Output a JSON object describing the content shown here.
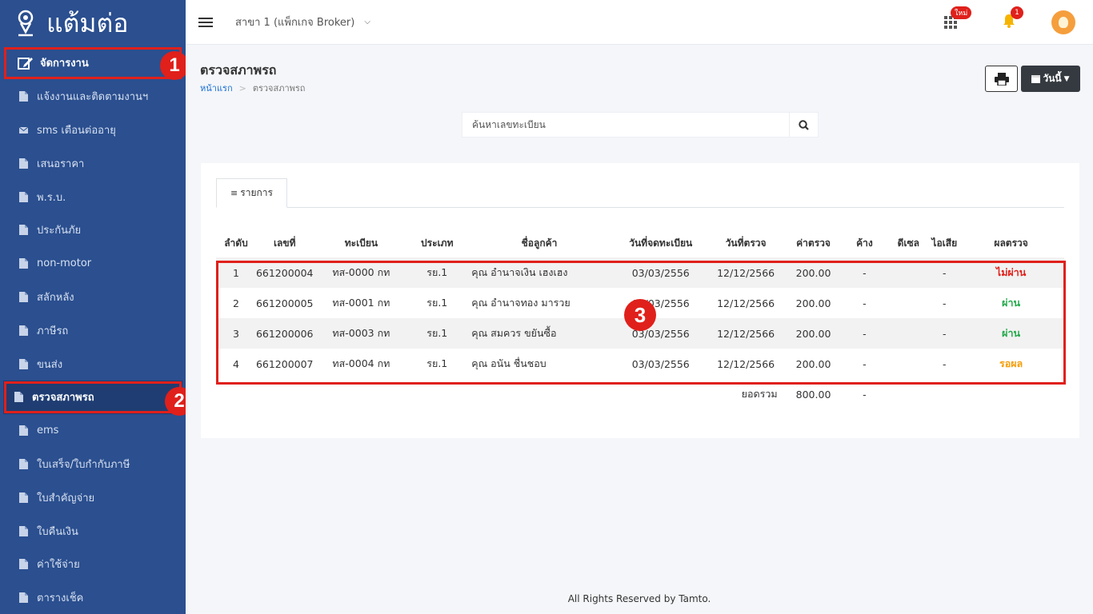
{
  "sidebar": {
    "logo_text": "แต้มต่อ",
    "items": [
      {
        "label": "จัดการงาน",
        "icon": "edit-icon"
      },
      {
        "label": "แจ้งงานและติดตามงานฯ",
        "icon": "file-icon"
      },
      {
        "label": "sms เตือนต่ออายุ",
        "icon": "envelope-icon"
      },
      {
        "label": "เสนอราคา",
        "icon": "file-icon"
      },
      {
        "label": "พ.ร.บ.",
        "icon": "file-icon"
      },
      {
        "label": "ประกันภัย",
        "icon": "file-icon"
      },
      {
        "label": "non-motor",
        "icon": "file-icon"
      },
      {
        "label": "สลักหลัง",
        "icon": "file-icon"
      },
      {
        "label": "ภาษีรถ",
        "icon": "file-icon"
      },
      {
        "label": "ขนส่ง",
        "icon": "file-icon"
      },
      {
        "label": "ตรวจสภาพรถ",
        "icon": "file-icon"
      },
      {
        "label": "ems",
        "icon": "file-icon"
      },
      {
        "label": "ใบเสร็จ/ใบกำกับภาษี",
        "icon": "file-icon"
      },
      {
        "label": "ใบสำคัญจ่าย",
        "icon": "file-icon"
      },
      {
        "label": "ใบคืนเงิน",
        "icon": "file-icon"
      },
      {
        "label": "ค่าใช้จ่าย",
        "icon": "file-icon"
      },
      {
        "label": "ตารางเช็ค",
        "icon": "file-icon"
      }
    ]
  },
  "annotations": {
    "one": "1",
    "two": "2",
    "three": "3"
  },
  "topbar": {
    "branch": "สาขา 1 (แพ็กเกจ Broker)",
    "new_badge": "ใหม่",
    "bell_count": "1"
  },
  "page": {
    "title": "ตรวจสภาพรถ",
    "breadcrumb_home": "หน้าแรก",
    "breadcrumb_current": "ตรวจสภาพรถ",
    "date_button": "วันนี้",
    "search_placeholder": "ค้นหาเลขทะเบียน",
    "tab_label": "รายการ"
  },
  "table": {
    "headers": [
      "ลำดับ",
      "เลขที่",
      "ทะเบียน",
      "ประเภท",
      "ชื่อลูกค้า",
      "วันที่จดทะเบียน",
      "วันที่ตรวจ",
      "ค่าตรวจ",
      "ค้าง",
      "ดีเซล",
      "ไอเสีย",
      "ผลตรวจ"
    ],
    "rows": [
      [
        "1",
        "661200004",
        "ทส-0000 กท",
        "รย.1",
        "คุณ อำนาจเงิน เฮงเฮง",
        "03/03/2556",
        "12/12/2566",
        "200.00",
        "-",
        "",
        "-",
        "ไม่ผ่าน"
      ],
      [
        "2",
        "661200005",
        "ทส-0001 กท",
        "รย.1",
        "คุณ อำนาจทอง มารวย",
        "03/03/2556",
        "12/12/2566",
        "200.00",
        "-",
        "",
        "-",
        "ผ่าน"
      ],
      [
        "3",
        "661200006",
        "ทส-0003 กท",
        "รย.1",
        "คุณ สมควร ขยันซื้อ",
        "03/03/2556",
        "12/12/2566",
        "200.00",
        "-",
        "",
        "-",
        "ผ่าน"
      ],
      [
        "4",
        "661200007",
        "ทส-0004 กท",
        "รย.1",
        "คุณ อนัน ชื่นชอบ",
        "03/03/2556",
        "12/12/2566",
        "200.00",
        "-",
        "",
        "-",
        "รอผล"
      ]
    ],
    "total_label": "ยอดรวม",
    "total_value": "800.00",
    "total_outstanding": "-"
  },
  "footer": "All Rights Reserved by Tamto.",
  "colors": {
    "sidebar": "#2b4f8f",
    "annotation": "#e0201b",
    "fail": "#e0201b",
    "pass": "#22a84a",
    "wait": "#f59e0b"
  }
}
